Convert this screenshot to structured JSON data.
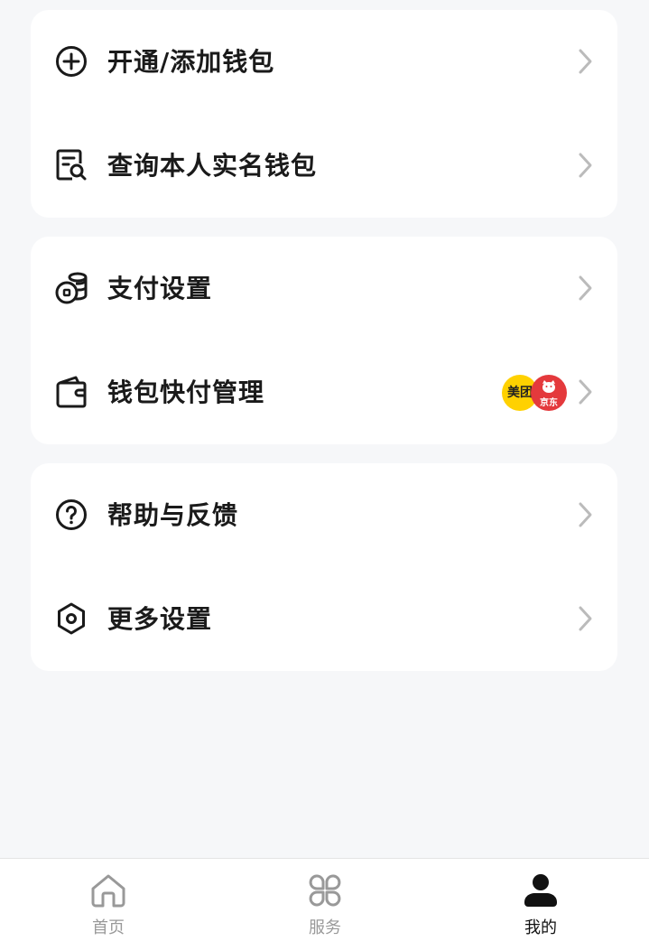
{
  "groups": [
    {
      "items": [
        {
          "label": "开通/添加钱包",
          "icon": "plus-circle-icon"
        },
        {
          "label": "查询本人实名钱包",
          "icon": "search-document-icon"
        }
      ]
    },
    {
      "items": [
        {
          "label": "支付设置",
          "icon": "coins-icon"
        },
        {
          "label": "钱包快付管理",
          "icon": "wallet-icon",
          "badges": [
            "美团",
            "京东"
          ]
        }
      ]
    },
    {
      "items": [
        {
          "label": "帮助与反馈",
          "icon": "help-circle-icon"
        },
        {
          "label": "更多设置",
          "icon": "hexagon-settings-icon"
        }
      ]
    }
  ],
  "bottom_nav": {
    "items": [
      {
        "label": "首页",
        "icon": "home-icon",
        "active": false
      },
      {
        "label": "服务",
        "icon": "grid-icon",
        "active": false
      },
      {
        "label": "我的",
        "icon": "user-icon",
        "active": true
      }
    ]
  },
  "colors": {
    "background": "#f6f7f9",
    "card": "#ffffff",
    "text": "#1a1a1a",
    "nav_inactive": "#999999",
    "nav_active": "#111111",
    "meituan": "#ffd100",
    "jd": "#e4393c"
  }
}
